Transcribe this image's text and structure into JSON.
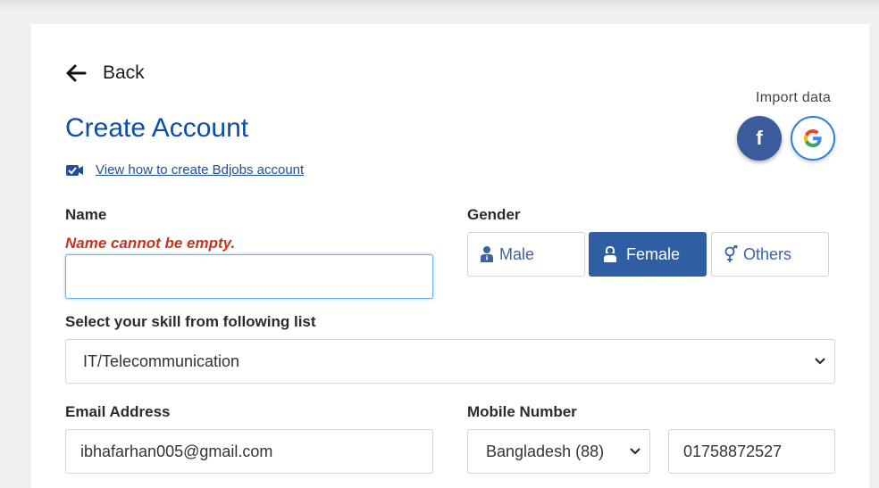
{
  "header": {
    "back_label": "Back",
    "title": "Create Account",
    "import_label": "Import data",
    "video_link": "View how to create Bdjobs account"
  },
  "icons": {
    "back": "arrow-left-icon",
    "video": "video-camera-icon",
    "facebook": "facebook-icon",
    "google": "google-icon",
    "male": "male-user-icon",
    "female": "female-user-icon",
    "others": "gender-symbol-icon",
    "dropdown": "chevron-down-icon"
  },
  "form": {
    "name": {
      "label": "Name",
      "error": "Name cannot be empty.",
      "value": ""
    },
    "gender": {
      "label": "Gender",
      "options": [
        "Male",
        "Female",
        "Others"
      ],
      "selected": "Female"
    },
    "skill": {
      "label": "Select your skill from following list",
      "value": "IT/Telecommunication"
    },
    "email": {
      "label": "Email Address",
      "value": "ibhafarhan005@gmail.com"
    },
    "mobile": {
      "label": "Mobile Number",
      "country": "Bangladesh (88)",
      "number": "01758872527"
    }
  },
  "colors": {
    "accent": "#2f5ea3",
    "title": "#0b4fa8",
    "error": "#c9341f",
    "facebook": "#3b5b9c"
  }
}
